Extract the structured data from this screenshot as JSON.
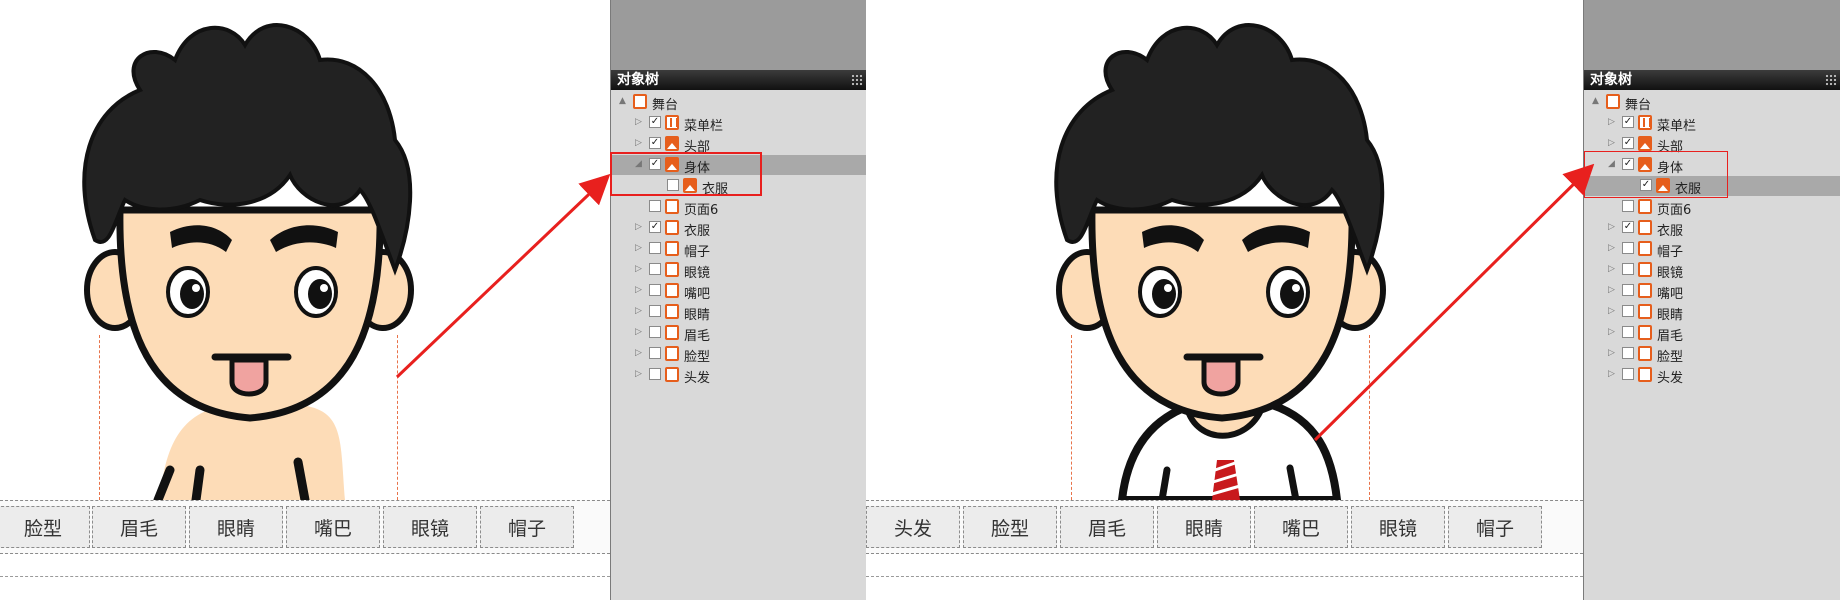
{
  "left": {
    "tabs": [
      "脸型",
      "眉毛",
      "眼睛",
      "嘴巴",
      "眼镜",
      "帽子"
    ],
    "panel": {
      "title": "对象树",
      "tree": [
        {
          "label": "舞台",
          "level": 0,
          "icon": "stage-icon",
          "tri": "▲",
          "checkbox": false
        },
        {
          "label": "菜单栏",
          "level": 1,
          "icon": "menubar-icon",
          "tri": "▷",
          "checkbox": true,
          "checked": true
        },
        {
          "label": "头部",
          "level": 1,
          "icon": "image-icon",
          "tri": "▷",
          "checkbox": true,
          "checked": true
        },
        {
          "label": "身体",
          "level": 1,
          "icon": "image-icon",
          "tri": "◢",
          "checkbox": true,
          "checked": true,
          "selected": true
        },
        {
          "label": "衣服",
          "level": 2,
          "icon": "image-icon",
          "tri": "",
          "checkbox": true,
          "checked": false
        },
        {
          "label": "页面6",
          "level": 1,
          "icon": "page-icon",
          "tri": "",
          "checkbox": true,
          "checked": false
        },
        {
          "label": "衣服",
          "level": 1,
          "icon": "page-icon",
          "tri": "▷",
          "checkbox": true,
          "checked": true
        },
        {
          "label": "帽子",
          "level": 1,
          "icon": "page-icon",
          "tri": "▷",
          "checkbox": true,
          "checked": false
        },
        {
          "label": "眼镜",
          "level": 1,
          "icon": "page-icon",
          "tri": "▷",
          "checkbox": true,
          "checked": false
        },
        {
          "label": "嘴吧",
          "level": 1,
          "icon": "page-icon",
          "tri": "▷",
          "checkbox": true,
          "checked": false
        },
        {
          "label": "眼睛",
          "level": 1,
          "icon": "page-icon",
          "tri": "▷",
          "checkbox": true,
          "checked": false
        },
        {
          "label": "眉毛",
          "level": 1,
          "icon": "page-icon",
          "tri": "▷",
          "checkbox": true,
          "checked": false
        },
        {
          "label": "脸型",
          "level": 1,
          "icon": "page-icon",
          "tri": "▷",
          "checkbox": true,
          "checked": false
        },
        {
          "label": "头发",
          "level": 1,
          "icon": "page-icon",
          "tri": "▷",
          "checkbox": true,
          "checked": false
        }
      ]
    }
  },
  "right": {
    "tabs": [
      "头发",
      "脸型",
      "眉毛",
      "眼睛",
      "嘴巴",
      "眼镜",
      "帽子"
    ],
    "panel": {
      "title": "对象树",
      "tree": [
        {
          "label": "舞台",
          "level": 0,
          "icon": "stage-icon",
          "tri": "▲",
          "checkbox": false
        },
        {
          "label": "菜单栏",
          "level": 1,
          "icon": "menubar-icon",
          "tri": "▷",
          "checkbox": true,
          "checked": true
        },
        {
          "label": "头部",
          "level": 1,
          "icon": "image-icon",
          "tri": "▷",
          "checkbox": true,
          "checked": true
        },
        {
          "label": "身体",
          "level": 1,
          "icon": "image-icon",
          "tri": "◢",
          "checkbox": true,
          "checked": true
        },
        {
          "label": "衣服",
          "level": 2,
          "icon": "image-icon",
          "tri": "",
          "checkbox": true,
          "checked": true,
          "selected": true
        },
        {
          "label": "页面6",
          "level": 1,
          "icon": "page-icon",
          "tri": "",
          "checkbox": true,
          "checked": false
        },
        {
          "label": "衣服",
          "level": 1,
          "icon": "page-icon",
          "tri": "▷",
          "checkbox": true,
          "checked": true
        },
        {
          "label": "帽子",
          "level": 1,
          "icon": "page-icon",
          "tri": "▷",
          "checkbox": true,
          "checked": false
        },
        {
          "label": "眼镜",
          "level": 1,
          "icon": "page-icon",
          "tri": "▷",
          "checkbox": true,
          "checked": false
        },
        {
          "label": "嘴吧",
          "level": 1,
          "icon": "page-icon",
          "tri": "▷",
          "checkbox": true,
          "checked": false
        },
        {
          "label": "眼睛",
          "level": 1,
          "icon": "page-icon",
          "tri": "▷",
          "checkbox": true,
          "checked": false
        },
        {
          "label": "眉毛",
          "level": 1,
          "icon": "page-icon",
          "tri": "▷",
          "checkbox": true,
          "checked": false
        },
        {
          "label": "脸型",
          "level": 1,
          "icon": "page-icon",
          "tri": "▷",
          "checkbox": true,
          "checked": false
        },
        {
          "label": "头发",
          "level": 1,
          "icon": "page-icon",
          "tri": "▷",
          "checkbox": true,
          "checked": false
        }
      ]
    }
  },
  "colors": {
    "accent": "#e65e1c",
    "highlight": "#e8201e",
    "panel_bg": "#d9d9d9",
    "hair": "#222222",
    "skin": "#fddcb7"
  }
}
